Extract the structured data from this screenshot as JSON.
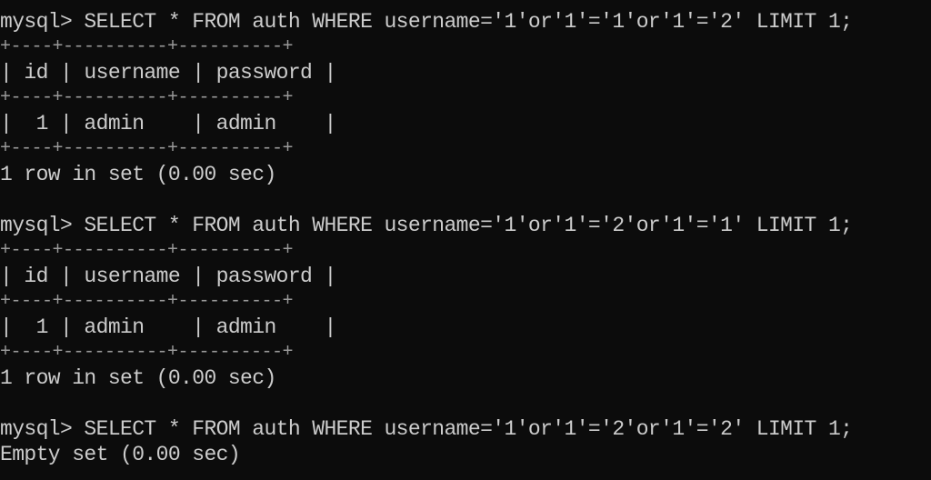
{
  "terminal": {
    "background": "#0c0c0c",
    "foreground": "#cccccc",
    "lines": [
      "mysql> SELECT * FROM auth WHERE username='1'or'1'='1'or'1'='2' LIMIT 1;",
      "+----+----------+----------+",
      "| id | username | password |",
      "+----+----------+----------+",
      "|  1 | admin    | admin    |",
      "+----+----------+----------+",
      "1 row in set (0.00 sec)",
      "",
      "mysql> SELECT * FROM auth WHERE username='1'or'1'='2'or'1'='1' LIMIT 1;",
      "+----+----------+----------+",
      "| id | username | password |",
      "+----+----------+----------+",
      "|  1 | admin    | admin    |",
      "+----+----------+----------+",
      "1 row in set (0.00 sec)",
      "",
      "mysql> SELECT * FROM auth WHERE username='1'or'1'='2'or'1'='2' LIMIT 1;",
      "Empty set (0.00 sec)"
    ]
  }
}
